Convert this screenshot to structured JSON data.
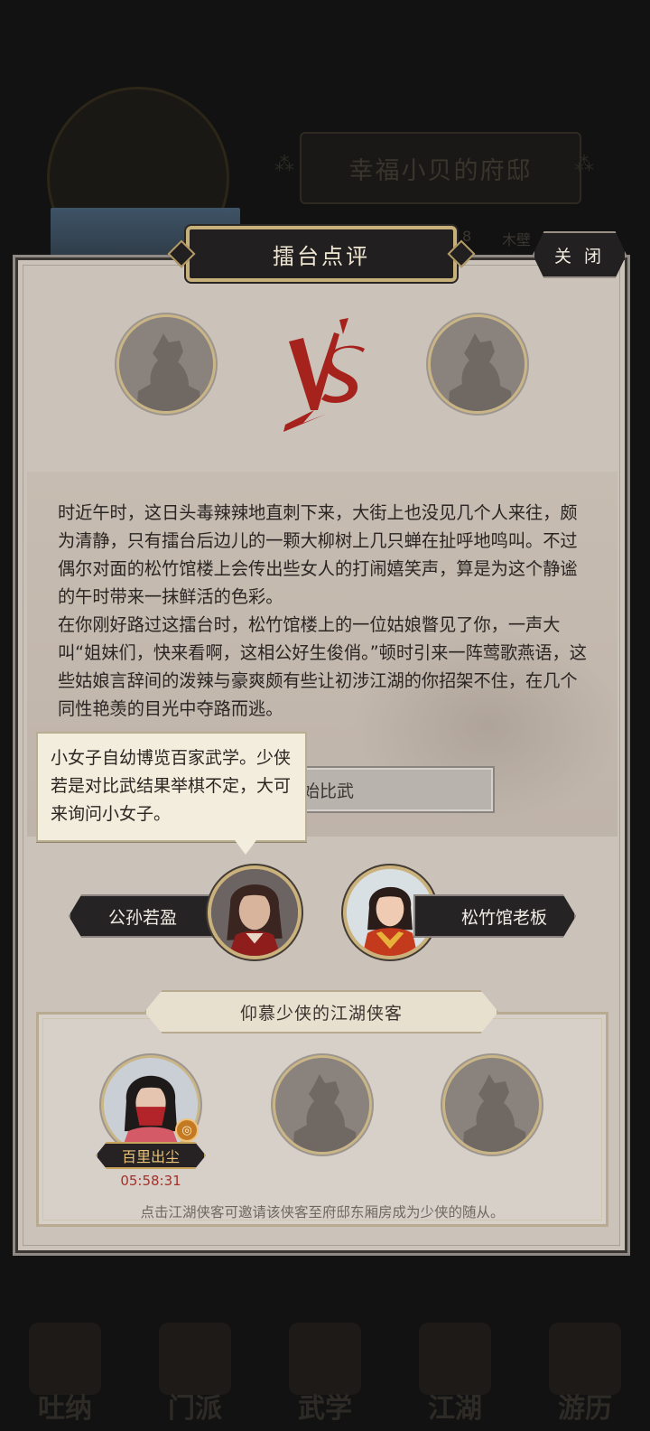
{
  "background": {
    "mansion_title": "幸福小贝的府邸",
    "partial_text_a": "8",
    "partial_text_b": "木壁",
    "nav": [
      {
        "label": "吐纳",
        "icon": "breathing-icon"
      },
      {
        "label": "门派",
        "icon": "sect-icon"
      },
      {
        "label": "武学",
        "icon": "martial-arts-icon"
      },
      {
        "label": "江湖",
        "icon": "jianghu-icon"
      },
      {
        "label": "游历",
        "icon": "travel-icon"
      }
    ]
  },
  "dialog": {
    "title": "擂台点评",
    "close_label": "关 闭",
    "vs_label": "VS",
    "story": [
      "时近午时，这日头毒辣辣地直刺下来，大街上也没见几个人来往，颇为清静，只有擂台后边儿的一颗大柳树上几只蝉在扯呼地鸣叫。不过偶尔对面的松竹馆楼上会传出些女人的打闹嬉笑声，算是为这个静谧的午时带来一抹鲜活的色彩。",
      "在你刚好路过这擂台时，松竹馆楼上的一位姑娘瞥见了你，一声大叫“姐妹们，快来看啊，这相公好生俊俏。”顿时引来一阵莺歌燕语，这些姑娘言辞间的泼辣与豪爽颇有些让初涉江湖的你招架不住，在几个同性艳羡的目光中夺路而逃。"
    ],
    "start_button": "开始比武",
    "tooltip": "小女子自幼博览百家武学。少侠若是对比武结果举棋不定，大可来询问小女子。",
    "npc_left_name": "公孙若盈",
    "npc_right_name": "松竹馆老板",
    "admirers_title": "仰慕少侠的江湖侠客",
    "admirer_name": "百里出尘",
    "admirer_timer": "05:58:31",
    "admirer_hint": "点击江湖侠客可邀请该侠客至府邸东厢房成为少侠的随从。"
  },
  "colors": {
    "panel_bg": "#cbc2ba",
    "title_plate": "#221f20",
    "gold_border": "#c8b07a",
    "vs_red": "#a5231c",
    "timer_red": "#a3312a"
  }
}
